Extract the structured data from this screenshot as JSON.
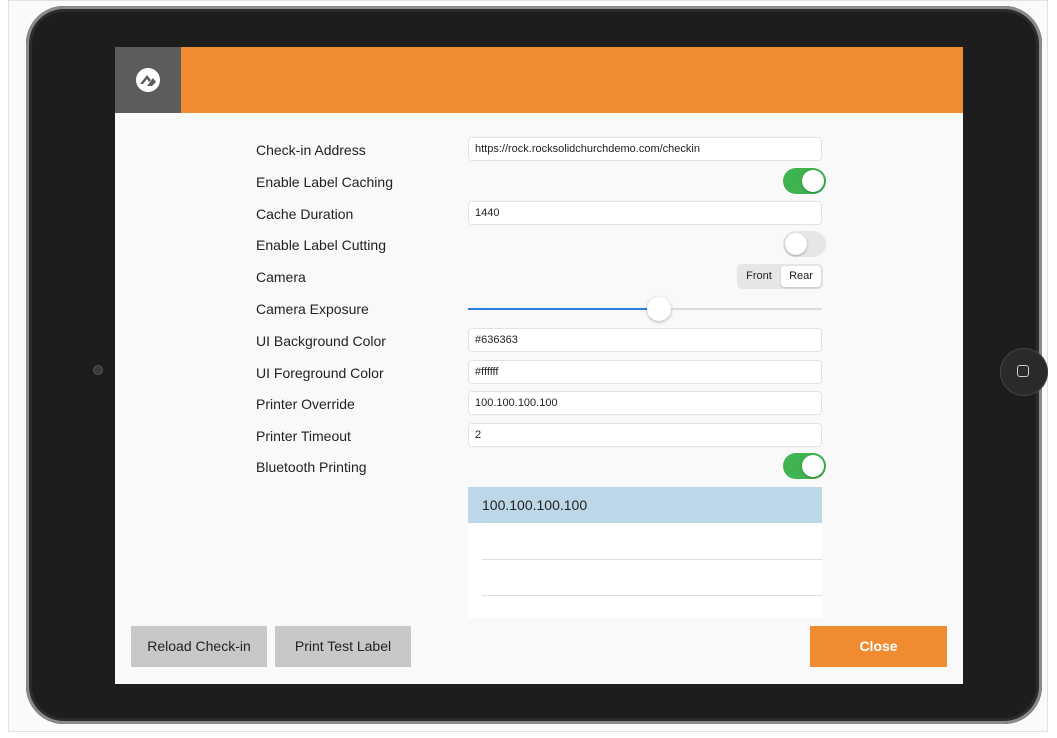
{
  "header": {
    "logo_icon": "rock-logo-icon",
    "accent_color": "#f18b32"
  },
  "settings": {
    "checkin_address": {
      "label": "Check-in Address",
      "value": "https://rock.rocksolidchurchdemo.com/checkin"
    },
    "enable_label_caching": {
      "label": "Enable Label Caching",
      "enabled": true
    },
    "cache_duration": {
      "label": "Cache Duration",
      "value": "1440"
    },
    "enable_label_cutting": {
      "label": "Enable Label Cutting",
      "enabled": false
    },
    "camera": {
      "label": "Camera",
      "options": [
        "Front",
        "Rear"
      ],
      "selected": "Rear"
    },
    "camera_exposure": {
      "label": "Camera Exposure",
      "level": 0.54
    },
    "ui_background_color": {
      "label": "UI Background Color",
      "value": "#636363"
    },
    "ui_foreground_color": {
      "label": "UI Foreground Color",
      "value": "#ffffff"
    },
    "printer_override": {
      "label": "Printer Override",
      "value": "100.100.100.100"
    },
    "printer_timeout": {
      "label": "Printer Timeout",
      "value": "2"
    },
    "bluetooth_printing": {
      "label": "Bluetooth Printing",
      "enabled": true
    }
  },
  "printer_list": {
    "items": [
      "100.100.100.100",
      "",
      "",
      ""
    ],
    "selected_index": 0
  },
  "footer": {
    "reload_label": "Reload Check-in",
    "print_test_label": "Print Test Label",
    "close_label": "Close"
  },
  "colors": {
    "toggle_on": "#3fb34f",
    "slider_fill": "#2b7de0",
    "selected_row": "#bcd7e7"
  }
}
